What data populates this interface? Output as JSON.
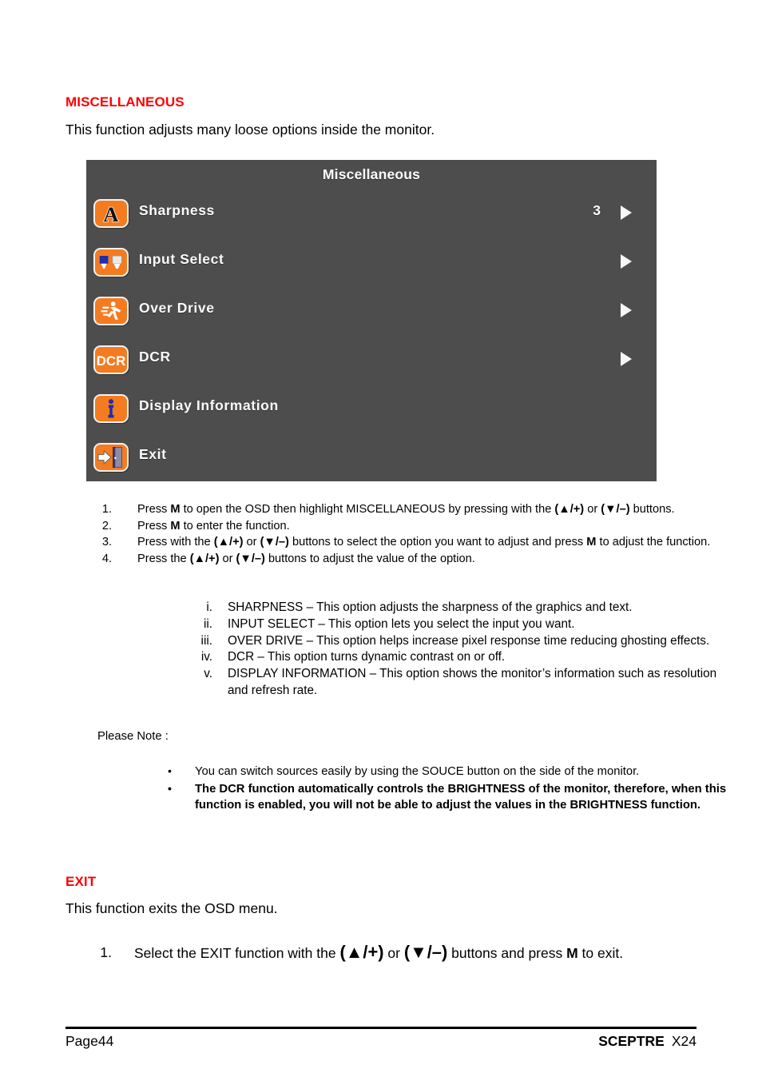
{
  "sections": {
    "misc": {
      "heading": "MISCELLANEOUS",
      "intro": "This function adjusts many loose options inside the monitor."
    },
    "exit": {
      "heading": "EXIT",
      "intro": "This function exits the OSD menu."
    }
  },
  "osd": {
    "title": "Miscellaneous",
    "background_color": "#4d4d4d",
    "icon_color": "#f47b20",
    "text_color": "#fbfbfb",
    "rows": [
      {
        "icon": "sharpness-letter-a-icon",
        "label": "Sharpness",
        "value": "3",
        "arrow": "▶"
      },
      {
        "icon": "input-select-connector-icon",
        "label": "Input Select",
        "value": "",
        "arrow": "▶"
      },
      {
        "icon": "over-drive-runner-icon",
        "label": "Over Drive",
        "value": "",
        "arrow": "▶"
      },
      {
        "icon": "dcr-icon",
        "label": "DCR",
        "value": "",
        "arrow": "▶"
      },
      {
        "icon": "display-information-info-icon",
        "label": "Display Information",
        "value": "",
        "arrow": ""
      },
      {
        "icon": "exit-door-icon",
        "label": "Exit",
        "value": "",
        "arrow": ""
      }
    ]
  },
  "procedure": [
    {
      "num": "1.",
      "parts": [
        {
          "t": "Press ",
          "s": "n"
        },
        {
          "t": "M",
          "s": "b"
        },
        {
          "t": " to open the OSD then highlight MISCELLANEOUS by pressing with the ",
          "s": "n"
        },
        {
          "t": "(▲/+)",
          "s": "k"
        },
        {
          "t": " or ",
          "s": "n"
        },
        {
          "t": "(▼/–)",
          "s": "k"
        },
        {
          "t": " buttons.",
          "s": "n"
        }
      ]
    },
    {
      "num": "2.",
      "parts": [
        {
          "t": "Press ",
          "s": "n"
        },
        {
          "t": "M",
          "s": "b"
        },
        {
          "t": " to enter the function.",
          "s": "n"
        }
      ]
    },
    {
      "num": "3.",
      "parts": [
        {
          "t": "Press with the ",
          "s": "n"
        },
        {
          "t": "(▲/+)",
          "s": "k"
        },
        {
          "t": " or ",
          "s": "n"
        },
        {
          "t": "(▼/–)",
          "s": "k"
        },
        {
          "t": " buttons to select the option you want to adjust and press ",
          "s": "n"
        },
        {
          "t": "M",
          "s": "b"
        },
        {
          "t": " to adjust the function.",
          "s": "n"
        }
      ]
    },
    {
      "num": "4.",
      "parts": [
        {
          "t": "Press the ",
          "s": "n"
        },
        {
          "t": "(▲/+)",
          "s": "k"
        },
        {
          "t": " or ",
          "s": "n"
        },
        {
          "t": "(▼/–)",
          "s": "k"
        },
        {
          "t": " buttons to adjust the value of the option.",
          "s": "n"
        }
      ]
    }
  ],
  "roman_items": [
    {
      "num": "i.",
      "text": "SHARPNESS – This option adjusts the sharpness of the graphics and text."
    },
    {
      "num": "ii.",
      "text": "INPUT SELECT – This option lets you select the input you want."
    },
    {
      "num": "iii.",
      "text": "OVER DRIVE – This option helps increase pixel response time reducing ghosting effects."
    },
    {
      "num": "iv.",
      "text": "DCR – This option turns dynamic contrast on or off."
    },
    {
      "num": "v.",
      "text": "DISPLAY INFORMATION – This option shows the monitor’s information such as resolution and refresh rate."
    }
  ],
  "note": {
    "label": "Please Note :",
    "bullet": "•",
    "items": [
      {
        "text": "You can switch sources easily by using the SOUCE button on the side of the monitor.",
        "bold": false
      },
      {
        "text": "The DCR function automatically controls the BRIGHTNESS of the monitor, therefore, when this function is enabled, you will not be able to adjust the values in the BRIGHTNESS function.",
        "bold": true
      }
    ]
  },
  "exit_steps": [
    {
      "num": "1.",
      "parts": [
        {
          "t": "Select the EXIT function with the ",
          "s": "n"
        },
        {
          "t": "(▲/+)",
          "s": "K"
        },
        {
          "t": " or ",
          "s": "n"
        },
        {
          "t": "(▼/–)",
          "s": "K"
        },
        {
          "t": " buttons and press ",
          "s": "n"
        },
        {
          "t": "M",
          "s": "b"
        },
        {
          "t": " to exit.",
          "s": "n"
        }
      ]
    }
  ],
  "footer": {
    "page": "Page44",
    "brand": "SCEPTRE",
    "model": "X24"
  },
  "colors": {
    "heading_red": "#ff0000",
    "body_black": "#000000"
  }
}
